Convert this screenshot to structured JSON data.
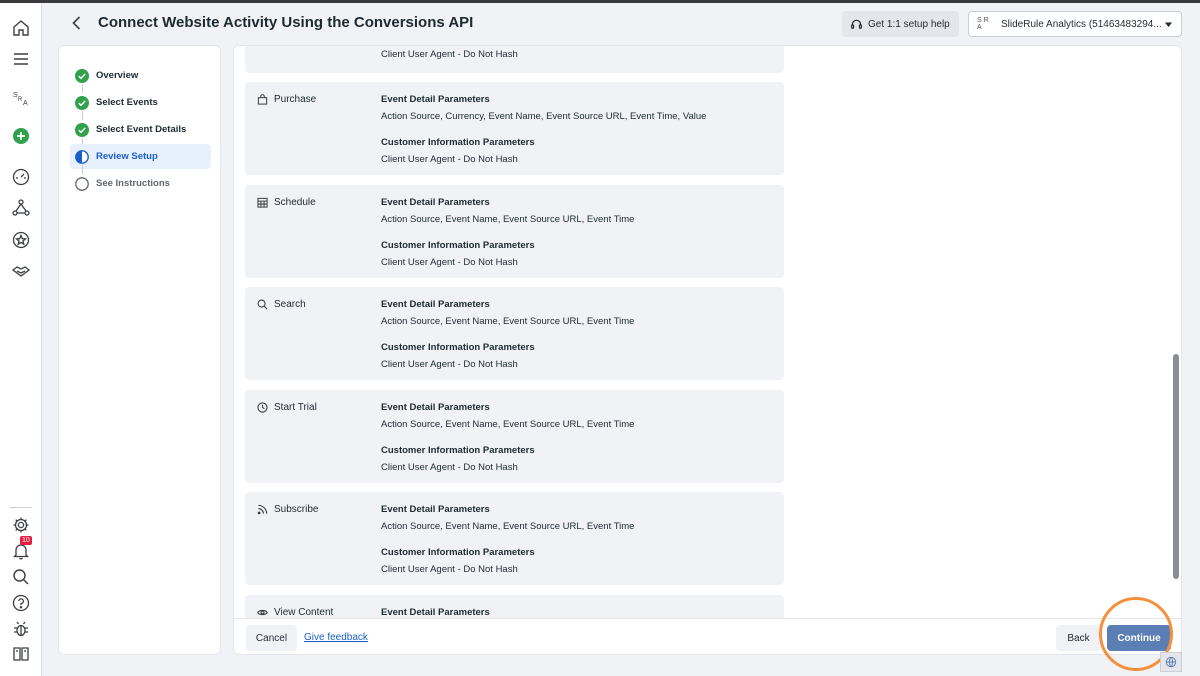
{
  "header": {
    "title": "Connect Website Activity Using the Conversions API",
    "help_label": "Get 1:1 setup help",
    "account_logo": "S R A",
    "account_name": "SlideRule Analytics (51463483294..."
  },
  "leftnav": {
    "icons": [
      "home-icon",
      "menu-icon",
      "account-logo-icon",
      "create-icon",
      "dashboard-icon",
      "network-icon",
      "star-icon",
      "handshake-icon"
    ],
    "bottom_icons": [
      "settings-icon",
      "notifications-icon",
      "search-icon",
      "help-icon",
      "bug-icon",
      "book-icon"
    ],
    "notification_count": "10"
  },
  "stepper": {
    "steps": [
      {
        "label": "Overview",
        "state": "done"
      },
      {
        "label": "Select Events",
        "state": "done"
      },
      {
        "label": "Select Event Details",
        "state": "done"
      },
      {
        "label": "Review Setup",
        "state": "active"
      },
      {
        "label": "See Instructions",
        "state": "todo"
      }
    ]
  },
  "cards": {
    "partial_top": {
      "value": "Client User Agent - Do Not Hash"
    },
    "items": [
      {
        "event": "Purchase",
        "icon": "shopping-bag-icon",
        "event_header": "Event Detail Parameters",
        "event_params": "Action Source, Currency, Event Name, Event Source URL, Event Time, Value",
        "customer_header": "Customer Information Parameters",
        "customer_params": "Client User Agent - Do Not Hash"
      },
      {
        "event": "Schedule",
        "icon": "calendar-icon",
        "event_header": "Event Detail Parameters",
        "event_params": "Action Source, Event Name, Event Source URL, Event Time",
        "customer_header": "Customer Information Parameters",
        "customer_params": "Client User Agent - Do Not Hash"
      },
      {
        "event": "Search",
        "icon": "search-icon",
        "event_header": "Event Detail Parameters",
        "event_params": "Action Source, Event Name, Event Source URL, Event Time",
        "customer_header": "Customer Information Parameters",
        "customer_params": "Client User Agent - Do Not Hash"
      },
      {
        "event": "Start Trial",
        "icon": "clock-icon",
        "event_header": "Event Detail Parameters",
        "event_params": "Action Source, Event Name, Event Source URL, Event Time",
        "customer_header": "Customer Information Parameters",
        "customer_params": "Client User Agent - Do Not Hash"
      },
      {
        "event": "Subscribe",
        "icon": "rss-icon",
        "event_header": "Event Detail Parameters",
        "event_params": "Action Source, Event Name, Event Source URL, Event Time",
        "customer_header": "Customer Information Parameters",
        "customer_params": "Client User Agent - Do Not Hash"
      },
      {
        "event": "View Content",
        "icon": "eye-icon",
        "event_header": "Event Detail Parameters"
      }
    ]
  },
  "footer": {
    "cancel_label": "Cancel",
    "feedback_label": "Give feedback",
    "back_label": "Back",
    "continue_label": "Continue"
  },
  "colors": {
    "accent": "#1a5fc7",
    "success": "#31a24c",
    "continue": "#5b7fb5",
    "highlight": "#f5913e"
  }
}
